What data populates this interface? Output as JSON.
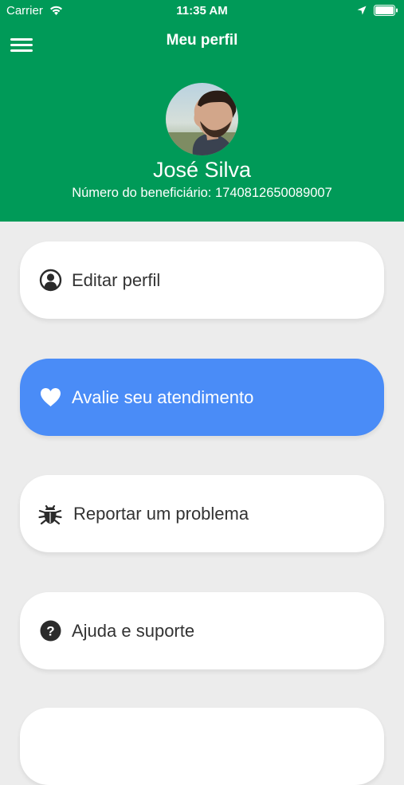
{
  "status_bar": {
    "carrier": "Carrier",
    "time": "11:35 AM"
  },
  "header": {
    "title": "Meu perfil",
    "name": "José Silva",
    "beneficiary": "Número do beneficiário: 1740812650089007"
  },
  "menu": {
    "items": [
      {
        "label": "Editar perfil",
        "icon": "user-circle-icon"
      },
      {
        "label": "Avalie seu atendimento",
        "icon": "heart-icon",
        "active": true
      },
      {
        "label": "Reportar um problema",
        "icon": "bug-icon"
      },
      {
        "label": "Ajuda e suporte",
        "icon": "help-circle-icon"
      }
    ]
  },
  "colors": {
    "header_bg": "#009a58",
    "active_card": "#4a8cf7",
    "page_bg": "#ececec"
  }
}
